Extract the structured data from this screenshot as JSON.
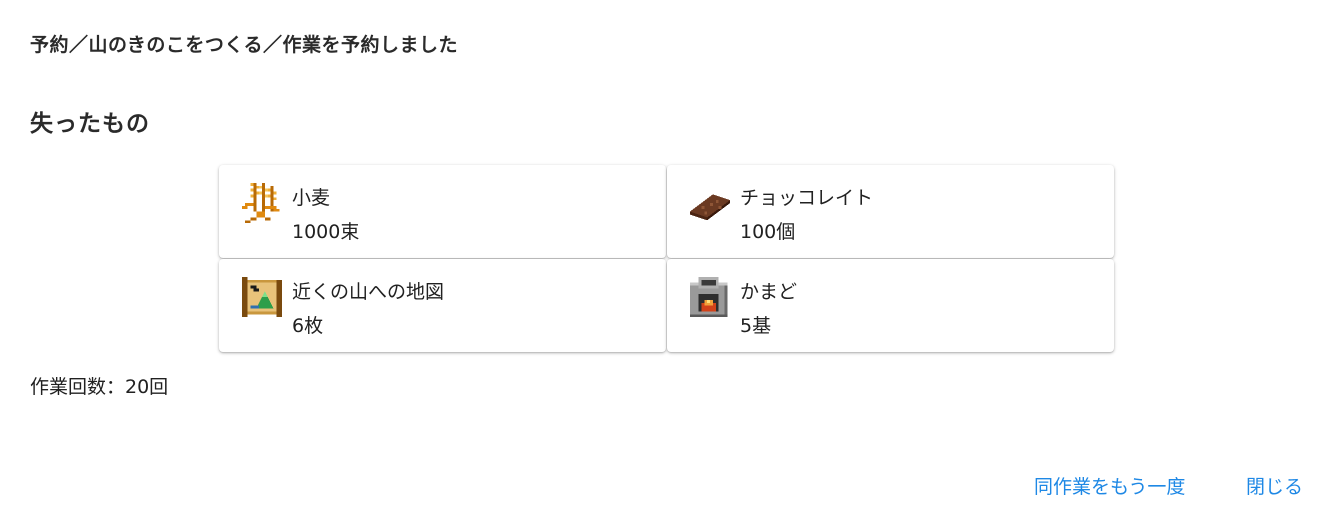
{
  "dialog": {
    "title": "予約／山のきのこをつくる／作業を予約しました"
  },
  "lost_items": {
    "heading": "失ったもの",
    "items": [
      {
        "name": "小麦",
        "quantity": "1000束",
        "icon": "wheat-icon"
      },
      {
        "name": "チョッコレイト",
        "quantity": "100個",
        "icon": "chocolate-icon"
      },
      {
        "name": "近くの山への地図",
        "quantity": "6枚",
        "icon": "map-scroll-icon"
      },
      {
        "name": "かまど",
        "quantity": "5基",
        "icon": "furnace-icon"
      }
    ]
  },
  "work_count": "作業回数：20回",
  "actions": {
    "repeat_label": "同作業をもう一度",
    "close_label": "閉じる"
  },
  "colors": {
    "accent": "#1e88e5",
    "text": "#212121"
  }
}
